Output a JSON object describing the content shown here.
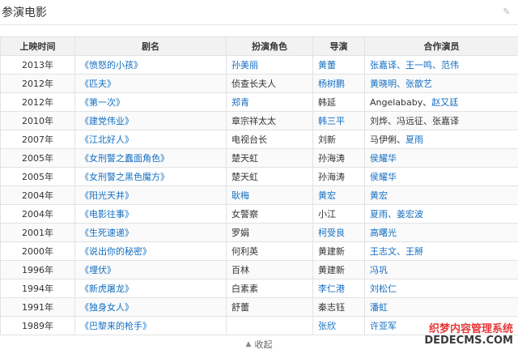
{
  "section": {
    "title": "参演电影"
  },
  "table": {
    "headers": [
      "上映时间",
      "剧名",
      "扮演角色",
      "导演",
      "合作演员"
    ],
    "rows": [
      {
        "year": "2013年",
        "title": "《愤怒的小孩》",
        "role": "孙美丽",
        "role_link": true,
        "director": "黄蕾",
        "director_link": true,
        "costars": [
          {
            "name": "张嘉译",
            "link": true
          },
          {
            "name": "王一鸣",
            "link": true
          },
          {
            "name": "范伟",
            "link": true
          }
        ]
      },
      {
        "year": "2012年",
        "title": "《匹夫》",
        "role": "侦查长夫人",
        "role_link": false,
        "director": "杨树鹏",
        "director_link": true,
        "costars": [
          {
            "name": "黄晓明",
            "link": true
          },
          {
            "name": "张歆艺",
            "link": true
          }
        ]
      },
      {
        "year": "2012年",
        "title": "《第一次》",
        "role": "郑青",
        "role_link": true,
        "director": "韩延",
        "director_link": false,
        "costars": [
          {
            "name": "Angelababy",
            "link": false
          },
          {
            "name": "赵又廷",
            "link": true
          }
        ]
      },
      {
        "year": "2010年",
        "title": "《建党伟业》",
        "role": "章宗祥太太",
        "role_link": false,
        "director": "韩三平",
        "director_link": true,
        "costars": [
          {
            "name": "刘烨",
            "link": false
          },
          {
            "name": "冯远征",
            "link": false
          },
          {
            "name": "张嘉译",
            "link": false
          }
        ]
      },
      {
        "year": "2007年",
        "title": "《江北好人》",
        "role": "电视台长",
        "role_link": false,
        "director": "刘新",
        "director_link": false,
        "costars": [
          {
            "name": "马伊俐",
            "link": false
          },
          {
            "name": "夏雨",
            "link": true
          }
        ]
      },
      {
        "year": "2005年",
        "title": "《女刑警之蠢面角色》",
        "role": "楚天虹",
        "role_link": false,
        "director": "孙海涛",
        "director_link": false,
        "costars": [
          {
            "name": "侯耀华",
            "link": true
          }
        ]
      },
      {
        "year": "2005年",
        "title": "《女刑警之黑色魔方》",
        "role": "楚天虹",
        "role_link": false,
        "director": "孙海涛",
        "director_link": false,
        "costars": [
          {
            "name": "侯耀华",
            "link": true
          }
        ]
      },
      {
        "year": "2004年",
        "title": "《阳光天井》",
        "role": "耿梅",
        "role_link": true,
        "director": "黄宏",
        "director_link": true,
        "costars": [
          {
            "name": "黄宏",
            "link": true
          }
        ]
      },
      {
        "year": "2004年",
        "title": "《电影往事》",
        "role": "女警察",
        "role_link": false,
        "director": "小江",
        "director_link": false,
        "costars": [
          {
            "name": "夏雨",
            "link": true
          },
          {
            "name": "姜宏波",
            "link": true
          }
        ]
      },
      {
        "year": "2001年",
        "title": "《生死速递》",
        "role": "罗娟",
        "role_link": false,
        "director": "柯受良",
        "director_link": true,
        "costars": [
          {
            "name": "高曙光",
            "link": true
          }
        ]
      },
      {
        "year": "2000年",
        "title": "《说出你的秘密》",
        "role": "何利英",
        "role_link": false,
        "director": "黄建新",
        "director_link": false,
        "costars": [
          {
            "name": "王志文",
            "link": true
          },
          {
            "name": "王掰",
            "link": true
          }
        ]
      },
      {
        "year": "1996年",
        "title": "《埋伏》",
        "role": "百林",
        "role_link": false,
        "director": "黄建新",
        "director_link": false,
        "costars": [
          {
            "name": "冯巩",
            "link": true
          }
        ]
      },
      {
        "year": "1994年",
        "title": "《新虎屠龙》",
        "role": "白素素",
        "role_link": false,
        "director": "李仁港",
        "director_link": true,
        "costars": [
          {
            "name": "刘松仁",
            "link": true
          }
        ]
      },
      {
        "year": "1991年",
        "title": "《独身女人》",
        "role": "舒蕾",
        "role_link": false,
        "director": "秦志钰",
        "director_link": false,
        "costars": [
          {
            "name": "潘虹",
            "link": true
          }
        ]
      },
      {
        "year": "1989年",
        "title": "《巴黎来的枪手》",
        "role": "",
        "role_link": false,
        "director": "张欣",
        "director_link": true,
        "costars": [
          {
            "name": "许亚军",
            "link": true
          }
        ]
      }
    ]
  },
  "collapse": {
    "label": "收起"
  },
  "watermark": {
    "line1": "织梦内容管理系统",
    "line2": "DEDECMS.COM"
  },
  "colors": {
    "link": "#136ec2",
    "header_bg": "#f2f2f2",
    "border": "#e2e2e2",
    "watermark_red": "#e63a3a"
  }
}
